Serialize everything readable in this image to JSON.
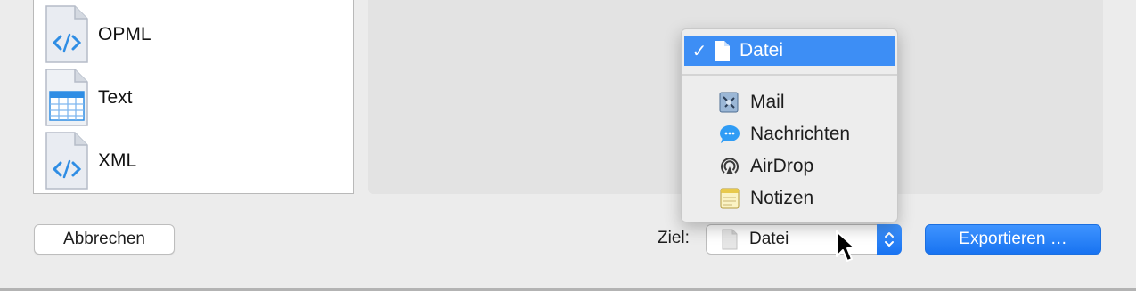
{
  "formats": [
    {
      "label": "OPML",
      "icon": "code-document-icon"
    },
    {
      "label": "Text",
      "icon": "table-document-icon"
    },
    {
      "label": "XML",
      "icon": "code-document-icon"
    }
  ],
  "footer": {
    "cancel_label": "Abbrechen",
    "destination_label": "Ziel:",
    "destination_value": "Datei",
    "export_label": "Exportieren …"
  },
  "destination_menu": {
    "items": [
      {
        "label": "Datei",
        "icon": "file-icon",
        "selected": true
      },
      {
        "label": "Mail",
        "icon": "mail-app-icon",
        "selected": false
      },
      {
        "label": "Nachrichten",
        "icon": "messages-icon",
        "selected": false
      },
      {
        "label": "AirDrop",
        "icon": "airdrop-icon",
        "selected": false
      },
      {
        "label": "Notizen",
        "icon": "notes-icon",
        "selected": false
      }
    ]
  },
  "colors": {
    "accent": "#3d8ef5",
    "window_bg": "#ececec",
    "list_bg": "#ffffff"
  }
}
